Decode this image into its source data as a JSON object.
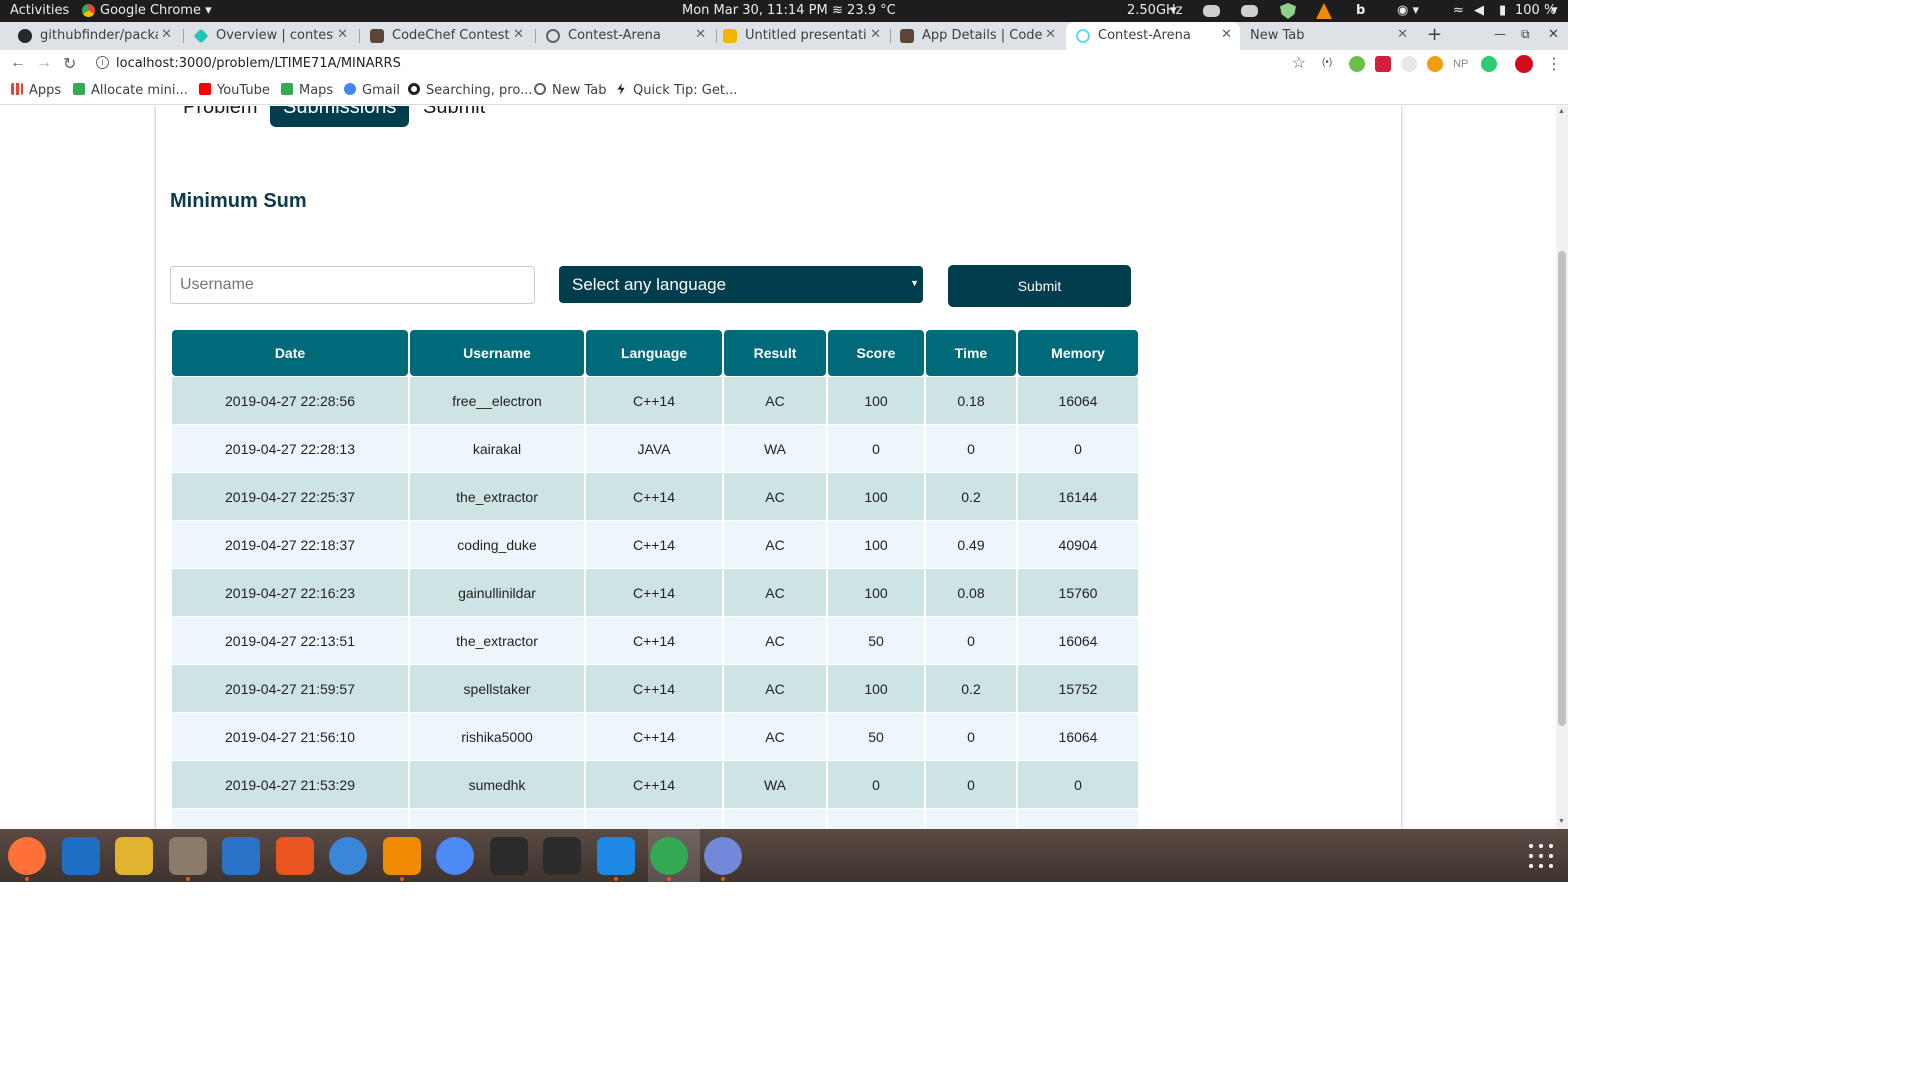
{
  "system_bar": {
    "activities": "Activities",
    "app_name": "Google Chrome",
    "datetime": "Mon Mar 30, 11:14 PM",
    "temperature": "23.9 °C",
    "cpu_freq": "2.50GHz",
    "battery": "100 %"
  },
  "tabs": [
    {
      "label": "githubfinder/package",
      "icon": "github-icon",
      "color": "#24292e"
    },
    {
      "label": "Overview | contestare",
      "icon": "netlify-icon",
      "color": "#20c6b7"
    },
    {
      "label": "CodeChef Contest Are",
      "icon": "codechef-icon",
      "color": "#5b4638"
    },
    {
      "label": "Contest-Arena",
      "icon": "globe-icon",
      "color": "#5f6368"
    },
    {
      "label": "Untitled presentation",
      "icon": "slides-icon",
      "color": "#f4b400"
    },
    {
      "label": "App Details | CodeChe",
      "icon": "codechef-icon",
      "color": "#5b4638"
    },
    {
      "label": "Contest-Arena",
      "icon": "react-icon",
      "color": "#61dafb",
      "active": true
    },
    {
      "label": "New Tab",
      "icon": "",
      "color": ""
    }
  ],
  "address_bar": {
    "url": "localhost:3000/problem/LTIME71A/MINARRS"
  },
  "bookmarks": [
    {
      "label": "Apps",
      "icon": "apps-grid-icon",
      "color": "#ea4335"
    },
    {
      "label": "Allocate mini...",
      "icon": "allocate-icon",
      "color": "#34a853"
    },
    {
      "label": "YouTube",
      "icon": "youtube-icon",
      "color": "#ff0000"
    },
    {
      "label": "Maps",
      "icon": "maps-icon",
      "color": "#34a853"
    },
    {
      "label": "Gmail",
      "icon": "google-icon",
      "color": "#4285f4"
    },
    {
      "label": "Searching, pro...",
      "icon": "search-bookmark-icon",
      "color": "#202124"
    },
    {
      "label": "New Tab",
      "icon": "globe-icon",
      "color": "#5f6368"
    },
    {
      "label": "Quick Tip: Get...",
      "icon": "tip-icon",
      "color": "#202124"
    }
  ],
  "page": {
    "nav_tabs": {
      "problem": "Problem",
      "submissions": "Submissions",
      "submit": "Submit"
    },
    "problem_title": "Minimum Sum",
    "username_placeholder": "Username",
    "language_select": "Select any language",
    "submit_label": "Submit",
    "table": {
      "columns": [
        "Date",
        "Username",
        "Language",
        "Result",
        "Score",
        "Time",
        "Memory"
      ],
      "rows": [
        [
          "2019-04-27 22:28:56",
          "free__electron",
          "C++14",
          "AC",
          "100",
          "0.18",
          "16064"
        ],
        [
          "2019-04-27 22:28:13",
          "kairakal",
          "JAVA",
          "WA",
          "0",
          "0",
          "0"
        ],
        [
          "2019-04-27 22:25:37",
          "the_extractor",
          "C++14",
          "AC",
          "100",
          "0.2",
          "16144"
        ],
        [
          "2019-04-27 22:18:37",
          "coding_duke",
          "C++14",
          "AC",
          "100",
          "0.49",
          "40904"
        ],
        [
          "2019-04-27 22:16:23",
          "gainullinildar",
          "C++14",
          "AC",
          "100",
          "0.08",
          "15760"
        ],
        [
          "2019-04-27 22:13:51",
          "the_extractor",
          "C++14",
          "AC",
          "50",
          "0",
          "16064"
        ],
        [
          "2019-04-27 21:59:57",
          "spellstaker",
          "C++14",
          "AC",
          "100",
          "0.2",
          "15752"
        ],
        [
          "2019-04-27 21:56:10",
          "rishika5000",
          "C++14",
          "AC",
          "50",
          "0",
          "16064"
        ],
        [
          "2019-04-27 21:53:29",
          "sumedhk",
          "C++14",
          "WA",
          "0",
          "0",
          "0"
        ],
        [
          "",
          "",
          "",
          "",
          "",
          "",
          ""
        ]
      ]
    }
  },
  "dock": [
    {
      "name": "firefox-icon",
      "color": "#ff7139",
      "running": true
    },
    {
      "name": "thunderbird-icon",
      "color": "#1f6fc5",
      "running": false
    },
    {
      "name": "rhythmbox-icon",
      "color": "#e0b331",
      "running": false
    },
    {
      "name": "files-icon",
      "color": "#8c7b6b",
      "running": true
    },
    {
      "name": "writer-icon",
      "color": "#2a73c8",
      "running": false
    },
    {
      "name": "software-icon",
      "color": "#e95420",
      "running": false
    },
    {
      "name": "help-icon",
      "color": "#3a87d9",
      "running": false
    },
    {
      "name": "vlc-icon",
      "color": "#f08a00",
      "running": true
    },
    {
      "name": "chromium-icon",
      "color": "#4c8bf5",
      "running": false
    },
    {
      "name": "intellij-icon",
      "color": "#2b2b2b",
      "running": false
    },
    {
      "name": "terminal-icon",
      "color": "#2c2c2c",
      "running": false
    },
    {
      "name": "vscode-icon",
      "color": "#1e88e5",
      "running": true
    },
    {
      "name": "chrome-icon",
      "color": "#34a853",
      "running": true
    },
    {
      "name": "discord-icon",
      "color": "#7289da",
      "running": true
    }
  ],
  "colors": {
    "accent": "#003d4d",
    "table_header": "#006a7a",
    "row_odd": "#cde3e4",
    "row_even": "#edf6fb"
  }
}
